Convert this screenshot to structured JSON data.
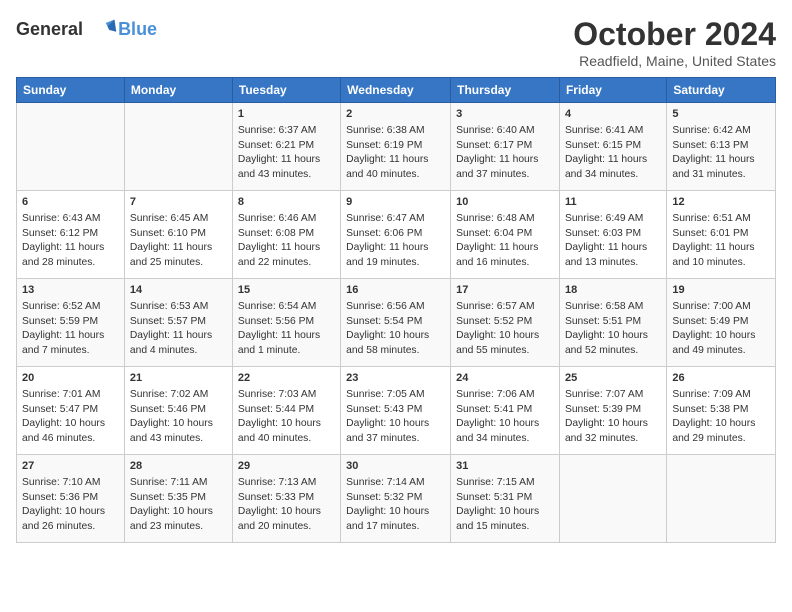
{
  "header": {
    "logo_line1": "General",
    "logo_line2": "Blue",
    "month": "October 2024",
    "location": "Readfield, Maine, United States"
  },
  "days_of_week": [
    "Sunday",
    "Monday",
    "Tuesday",
    "Wednesday",
    "Thursday",
    "Friday",
    "Saturday"
  ],
  "weeks": [
    [
      {
        "day": "",
        "info": ""
      },
      {
        "day": "",
        "info": ""
      },
      {
        "day": "1",
        "info": "Sunrise: 6:37 AM\nSunset: 6:21 PM\nDaylight: 11 hours and 43 minutes."
      },
      {
        "day": "2",
        "info": "Sunrise: 6:38 AM\nSunset: 6:19 PM\nDaylight: 11 hours and 40 minutes."
      },
      {
        "day": "3",
        "info": "Sunrise: 6:40 AM\nSunset: 6:17 PM\nDaylight: 11 hours and 37 minutes."
      },
      {
        "day": "4",
        "info": "Sunrise: 6:41 AM\nSunset: 6:15 PM\nDaylight: 11 hours and 34 minutes."
      },
      {
        "day": "5",
        "info": "Sunrise: 6:42 AM\nSunset: 6:13 PM\nDaylight: 11 hours and 31 minutes."
      }
    ],
    [
      {
        "day": "6",
        "info": "Sunrise: 6:43 AM\nSunset: 6:12 PM\nDaylight: 11 hours and 28 minutes."
      },
      {
        "day": "7",
        "info": "Sunrise: 6:45 AM\nSunset: 6:10 PM\nDaylight: 11 hours and 25 minutes."
      },
      {
        "day": "8",
        "info": "Sunrise: 6:46 AM\nSunset: 6:08 PM\nDaylight: 11 hours and 22 minutes."
      },
      {
        "day": "9",
        "info": "Sunrise: 6:47 AM\nSunset: 6:06 PM\nDaylight: 11 hours and 19 minutes."
      },
      {
        "day": "10",
        "info": "Sunrise: 6:48 AM\nSunset: 6:04 PM\nDaylight: 11 hours and 16 minutes."
      },
      {
        "day": "11",
        "info": "Sunrise: 6:49 AM\nSunset: 6:03 PM\nDaylight: 11 hours and 13 minutes."
      },
      {
        "day": "12",
        "info": "Sunrise: 6:51 AM\nSunset: 6:01 PM\nDaylight: 11 hours and 10 minutes."
      }
    ],
    [
      {
        "day": "13",
        "info": "Sunrise: 6:52 AM\nSunset: 5:59 PM\nDaylight: 11 hours and 7 minutes."
      },
      {
        "day": "14",
        "info": "Sunrise: 6:53 AM\nSunset: 5:57 PM\nDaylight: 11 hours and 4 minutes."
      },
      {
        "day": "15",
        "info": "Sunrise: 6:54 AM\nSunset: 5:56 PM\nDaylight: 11 hours and 1 minute."
      },
      {
        "day": "16",
        "info": "Sunrise: 6:56 AM\nSunset: 5:54 PM\nDaylight: 10 hours and 58 minutes."
      },
      {
        "day": "17",
        "info": "Sunrise: 6:57 AM\nSunset: 5:52 PM\nDaylight: 10 hours and 55 minutes."
      },
      {
        "day": "18",
        "info": "Sunrise: 6:58 AM\nSunset: 5:51 PM\nDaylight: 10 hours and 52 minutes."
      },
      {
        "day": "19",
        "info": "Sunrise: 7:00 AM\nSunset: 5:49 PM\nDaylight: 10 hours and 49 minutes."
      }
    ],
    [
      {
        "day": "20",
        "info": "Sunrise: 7:01 AM\nSunset: 5:47 PM\nDaylight: 10 hours and 46 minutes."
      },
      {
        "day": "21",
        "info": "Sunrise: 7:02 AM\nSunset: 5:46 PM\nDaylight: 10 hours and 43 minutes."
      },
      {
        "day": "22",
        "info": "Sunrise: 7:03 AM\nSunset: 5:44 PM\nDaylight: 10 hours and 40 minutes."
      },
      {
        "day": "23",
        "info": "Sunrise: 7:05 AM\nSunset: 5:43 PM\nDaylight: 10 hours and 37 minutes."
      },
      {
        "day": "24",
        "info": "Sunrise: 7:06 AM\nSunset: 5:41 PM\nDaylight: 10 hours and 34 minutes."
      },
      {
        "day": "25",
        "info": "Sunrise: 7:07 AM\nSunset: 5:39 PM\nDaylight: 10 hours and 32 minutes."
      },
      {
        "day": "26",
        "info": "Sunrise: 7:09 AM\nSunset: 5:38 PM\nDaylight: 10 hours and 29 minutes."
      }
    ],
    [
      {
        "day": "27",
        "info": "Sunrise: 7:10 AM\nSunset: 5:36 PM\nDaylight: 10 hours and 26 minutes."
      },
      {
        "day": "28",
        "info": "Sunrise: 7:11 AM\nSunset: 5:35 PM\nDaylight: 10 hours and 23 minutes."
      },
      {
        "day": "29",
        "info": "Sunrise: 7:13 AM\nSunset: 5:33 PM\nDaylight: 10 hours and 20 minutes."
      },
      {
        "day": "30",
        "info": "Sunrise: 7:14 AM\nSunset: 5:32 PM\nDaylight: 10 hours and 17 minutes."
      },
      {
        "day": "31",
        "info": "Sunrise: 7:15 AM\nSunset: 5:31 PM\nDaylight: 10 hours and 15 minutes."
      },
      {
        "day": "",
        "info": ""
      },
      {
        "day": "",
        "info": ""
      }
    ]
  ]
}
